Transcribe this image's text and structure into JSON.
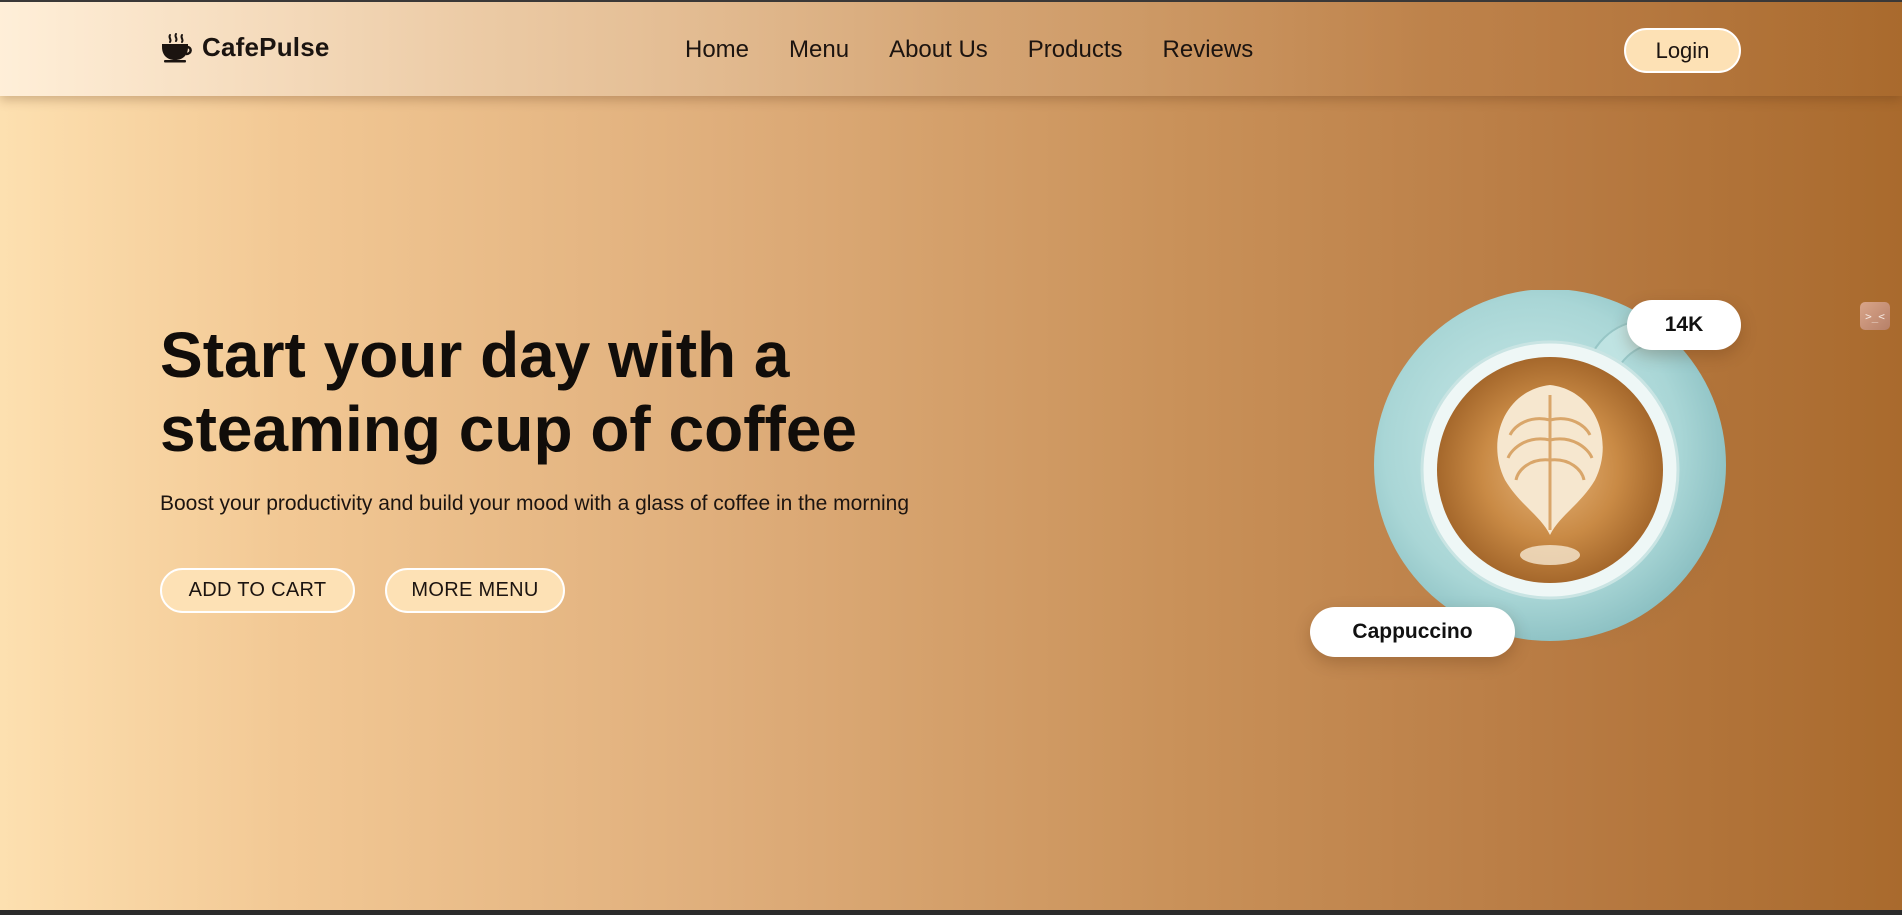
{
  "brand": {
    "name": "CafePulse",
    "icon": "coffee-cup-icon"
  },
  "nav": {
    "items": [
      {
        "label": "Home"
      },
      {
        "label": "Menu"
      },
      {
        "label": "About Us"
      },
      {
        "label": "Products"
      },
      {
        "label": "Reviews"
      }
    ],
    "login_label": "Login"
  },
  "hero": {
    "title_line1": "Start your day with a",
    "title_line2": "steaming cup of coffee",
    "subtitle": "Boost your productivity and build your mood with a glass of coffee in the morning",
    "add_to_cart_label": "ADD TO CART",
    "more_menu_label": "MORE MENU"
  },
  "featured": {
    "count_label": "14K",
    "product_name": "Cappuccino",
    "image": "cappuccino-cup-image"
  },
  "side_widget": {
    "icon": "terminal-icon",
    "glyph": ">_<"
  },
  "colors": {
    "gradient_start": "#fde0b0",
    "gradient_end": "#a96a2d",
    "button_fill": "#fde1b5",
    "text_dark": "#110d0a",
    "cup_saucer": "#a9d6d6"
  }
}
